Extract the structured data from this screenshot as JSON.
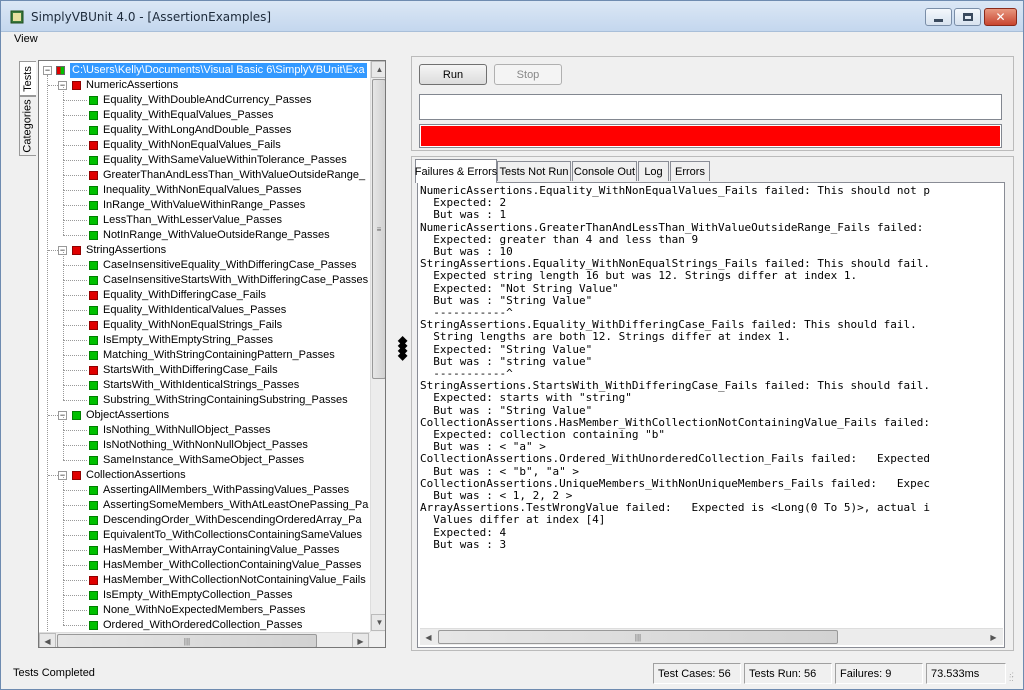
{
  "window": {
    "title": "SimplyVBUnit 4.0 - [AssertionExamples]",
    "menu_view": "View"
  },
  "side_tabs": {
    "tests": "Tests",
    "categories": "Categories"
  },
  "tree": {
    "root": "C:\\Users\\Kelly\\Documents\\Visual Basic 6\\SimplyVBUnit\\Exa",
    "nodes": [
      {
        "level": 1,
        "label": "NumericAssertions",
        "status": "red",
        "group": true
      },
      {
        "level": 2,
        "label": "Equality_WithDoubleAndCurrency_Passes",
        "status": "green"
      },
      {
        "level": 2,
        "label": "Equality_WithEqualValues_Passes",
        "status": "green"
      },
      {
        "level": 2,
        "label": "Equality_WithLongAndDouble_Passes",
        "status": "green"
      },
      {
        "level": 2,
        "label": "Equality_WithNonEqualValues_Fails",
        "status": "red"
      },
      {
        "level": 2,
        "label": "Equality_WithSameValueWithinTolerance_Passes",
        "status": "green"
      },
      {
        "level": 2,
        "label": "GreaterThanAndLessThan_WithValueOutsideRange_",
        "status": "red"
      },
      {
        "level": 2,
        "label": "Inequality_WithNonEqualValues_Passes",
        "status": "green"
      },
      {
        "level": 2,
        "label": "InRange_WithValueWithinRange_Passes",
        "status": "green"
      },
      {
        "level": 2,
        "label": "LessThan_WithLesserValue_Passes",
        "status": "green"
      },
      {
        "level": 2,
        "label": "NotInRange_WithValueOutsideRange_Passes",
        "status": "green"
      },
      {
        "level": 1,
        "label": "StringAssertions",
        "status": "red",
        "group": true
      },
      {
        "level": 2,
        "label": "CaseInsensitiveEquality_WithDifferingCase_Passes",
        "status": "green"
      },
      {
        "level": 2,
        "label": "CaseInsensitiveStartsWith_WithDifferingCase_Passes",
        "status": "green"
      },
      {
        "level": 2,
        "label": "Equality_WithDifferingCase_Fails",
        "status": "red"
      },
      {
        "level": 2,
        "label": "Equality_WithIdenticalValues_Passes",
        "status": "green"
      },
      {
        "level": 2,
        "label": "Equality_WithNonEqualStrings_Fails",
        "status": "red"
      },
      {
        "level": 2,
        "label": "IsEmpty_WithEmptyString_Passes",
        "status": "green"
      },
      {
        "level": 2,
        "label": "Matching_WithStringContainingPattern_Passes",
        "status": "green"
      },
      {
        "level": 2,
        "label": "StartsWith_WithDifferingCase_Fails",
        "status": "red"
      },
      {
        "level": 2,
        "label": "StartsWith_WithIdenticalStrings_Passes",
        "status": "green"
      },
      {
        "level": 2,
        "label": "Substring_WithStringContainingSubstring_Passes",
        "status": "green"
      },
      {
        "level": 1,
        "label": "ObjectAssertions",
        "status": "green",
        "group": true
      },
      {
        "level": 2,
        "label": "IsNothing_WithNullObject_Passes",
        "status": "green"
      },
      {
        "level": 2,
        "label": "IsNotNothing_WithNonNullObject_Passes",
        "status": "green"
      },
      {
        "level": 2,
        "label": "SameInstance_WithSameObject_Passes",
        "status": "green"
      },
      {
        "level": 1,
        "label": "CollectionAssertions",
        "status": "red",
        "group": true
      },
      {
        "level": 2,
        "label": "AssertingAllMembers_WithPassingValues_Passes",
        "status": "green"
      },
      {
        "level": 2,
        "label": "AssertingSomeMembers_WithAtLeastOnePassing_Pa",
        "status": "green"
      },
      {
        "level": 2,
        "label": "DescendingOrder_WithDescendingOrderedArray_Pa",
        "status": "green"
      },
      {
        "level": 2,
        "label": "EquivalentTo_WithCollectionsContainingSameValues",
        "status": "green"
      },
      {
        "level": 2,
        "label": "HasMember_WithArrayContainingValue_Passes",
        "status": "green"
      },
      {
        "level": 2,
        "label": "HasMember_WithCollectionContainingValue_Passes",
        "status": "green"
      },
      {
        "level": 2,
        "label": "HasMember_WithCollectionNotContainingValue_Fails",
        "status": "red"
      },
      {
        "level": 2,
        "label": "IsEmpty_WithEmptyCollection_Passes",
        "status": "green"
      },
      {
        "level": 2,
        "label": "None_WithNoExpectedMembers_Passes",
        "status": "green"
      },
      {
        "level": 2,
        "label": "Ordered_WithOrderedCollection_Passes",
        "status": "green"
      }
    ]
  },
  "toolbar": {
    "run_label": "Run",
    "stop_label": "Stop"
  },
  "progress": {
    "state": "failed",
    "color": "#ff0000",
    "fraction": 1.0
  },
  "tabs": [
    "Failures & Errors",
    "Tests Not Run",
    "Console Out",
    "Log",
    "Errors"
  ],
  "active_tab": "Failures & Errors",
  "output_lines": [
    "NumericAssertions.Equality_WithNonEqualValues_Fails failed: This should not p",
    "  Expected: 2",
    "  But was : 1",
    "NumericAssertions.GreaterThanAndLessThan_WithValueOutsideRange_Fails failed:",
    "  Expected: greater than 4 and less than 9",
    "  But was : 10",
    "StringAssertions.Equality_WithNonEqualStrings_Fails failed: This should fail.",
    "  Expected string length 16 but was 12. Strings differ at index 1.",
    "  Expected: \"Not String Value\"",
    "  But was : \"String Value\"",
    "  -----------^",
    "StringAssertions.Equality_WithDifferingCase_Fails failed: This should fail.",
    "  String lengths are both 12. Strings differ at index 1.",
    "  Expected: \"String Value\"",
    "  But was : \"string value\"",
    "  -----------^",
    "StringAssertions.StartsWith_WithDifferingCase_Fails failed: This should fail.",
    "  Expected: starts with \"string\"",
    "  But was : \"String Value\"",
    "CollectionAssertions.HasMember_WithCollectionNotContainingValue_Fails failed:",
    "  Expected: collection containing \"b\"",
    "  But was : < \"a\" >",
    "CollectionAssertions.Ordered_WithUnorderedCollection_Fails failed:   Expected",
    "  But was : < \"b\", \"a\" >",
    "CollectionAssertions.UniqueMembers_WithNonUniqueMembers_Fails failed:   Expec",
    "  But was : < 1, 2, 2 >",
    "ArrayAssertions.TestWrongValue failed:   Expected is <Long(0 To 5)>, actual i",
    "  Values differ at index [4]",
    "  Expected: 4",
    "  But was : 3"
  ],
  "status": {
    "message": "Tests Completed",
    "test_cases": "Test Cases: 56",
    "tests_run": "Tests Run: 56",
    "failures": "Failures: 9",
    "time": "73.533ms"
  }
}
